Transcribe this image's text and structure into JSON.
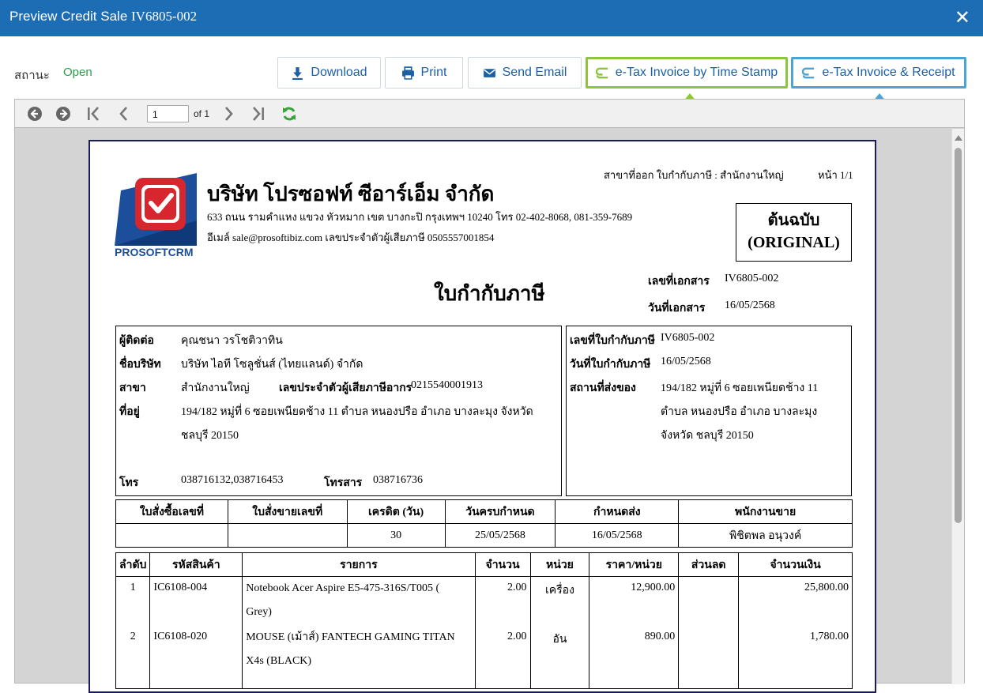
{
  "window": {
    "title": "Preview Credit Sale",
    "doc_no": "IV6805-002"
  },
  "status": {
    "label": "สถานะ",
    "value": "Open"
  },
  "buttons": {
    "download": "Download",
    "print": "Print",
    "send_email": "Send Email",
    "etax_timestamp": "e-Tax Invoice by Time Stamp",
    "etax_receipt": "e-Tax Invoice & Receipt"
  },
  "toolbar": {
    "page": "1",
    "of": "of 1"
  },
  "colors": {
    "header": "#1d6db5",
    "green": "#8cc63f",
    "blue": "#4ba3d6",
    "status_open": "#2a9d4a"
  },
  "doc": {
    "branch": "สาขาที่ออก ใบกำกับภาษี : สำนักงานใหญ่",
    "page": "หน้า 1/1",
    "company_name": "บริษัท โปรซอฟท์ ซีอาร์เอ็ม จำกัด",
    "address": "633 ถนน รามคำแหง แขวง หัวหมาก เขต บางกะปิ กรุงเทพฯ 10240 โทร 02-402-8068, 081-359-7689",
    "email_tax": "อีเมล์ sale@prosoftibiz.com เลขประจำตัวผู้เสียภาษี 0505557001854",
    "logo_text": "PROSOFTCRM",
    "original_th": "ต้นฉบับ",
    "original_en": "(ORIGINAL)",
    "doc_title": "ใบกำกับภาษี",
    "docno_label": "เลขที่เอกสาร",
    "docno_value": "IV6805-002",
    "docdate_label": "วันที่เอกสาร",
    "docdate_value": "16/05/2568",
    "contact_label": "ผู้ติดต่อ",
    "contact_value": "คุณชนา วรโชติวาทิน",
    "company_label": "ชื่อบริษัท",
    "company_value": "บริษัท ไอที โซลูชั่นส์ (ไทยแลนด์) จำกัด",
    "branch_label": "สาขา",
    "branch_value": "สำนักงานใหญ่",
    "taxid_label": "เลขประจำตัวผู้เสียภาษีอากร",
    "taxid_value": "0215540001913",
    "addr_label": "ที่อยู่",
    "addr_value1": "194/182 หมู่ที่ 6 ซอยเพนียดช้าง 11 ตำบล หนองปรือ อำเภอ บางละมุง จังหวัด",
    "addr_value2": "ชลบุรี 20150",
    "tel_label": "โทร",
    "tel_value": "038716132,038716453",
    "fax_label": "โทรสาร",
    "fax_value": "038716736",
    "inv_label": "เลขที่ใบกำกับภาษี",
    "inv_value": "IV6805-002",
    "invdate_label": "วันที่ใบกำกับภาษี",
    "invdate_value": "16/05/2568",
    "ship_label": "สถานที่ส่งของ",
    "ship_value1": "194/182 หมู่ที่ 6 ซอยเพนียดช้าง 11",
    "ship_value2": "ตำบล หนองปรือ อำเภอ บางละมุง",
    "ship_value3": "จังหวัด ชลบุรี 20150",
    "order_headers": [
      "ใบสั่งซื้อเลขที่",
      "ใบสั่งขายเลขที่",
      "เครดิต (วัน)",
      "วันครบกำหนด",
      "กำหนดส่ง",
      "พนักงานขาย"
    ],
    "order_values": [
      "",
      "",
      "30",
      "25/05/2568",
      "16/05/2568",
      "พิชิตพล อนุวงค์"
    ],
    "item_headers": [
      "ลำดับ",
      "รหัสสินค้า",
      "รายการ",
      "จำนวน",
      "หน่วย",
      "ราคา/หน่วย",
      "ส่วนลด",
      "จำนวนเงิน"
    ],
    "items": [
      {
        "no": "1",
        "code": "IC6108-004",
        "desc1": "Notebook Acer Aspire E5-475-316S/T005 (",
        "desc2": "Grey)",
        "qty": "2.00",
        "unit": "เครื่อง",
        "price": "12,900.00",
        "disc": "",
        "amount": "25,800.00"
      },
      {
        "no": "2",
        "code": "IC6108-020",
        "desc1": "MOUSE (เม้าส์) FANTECH GAMING TITAN",
        "desc2": "X4s (BLACK)",
        "qty": "2.00",
        "unit": "อัน",
        "price": "890.00",
        "disc": "",
        "amount": "1,780.00"
      }
    ]
  }
}
